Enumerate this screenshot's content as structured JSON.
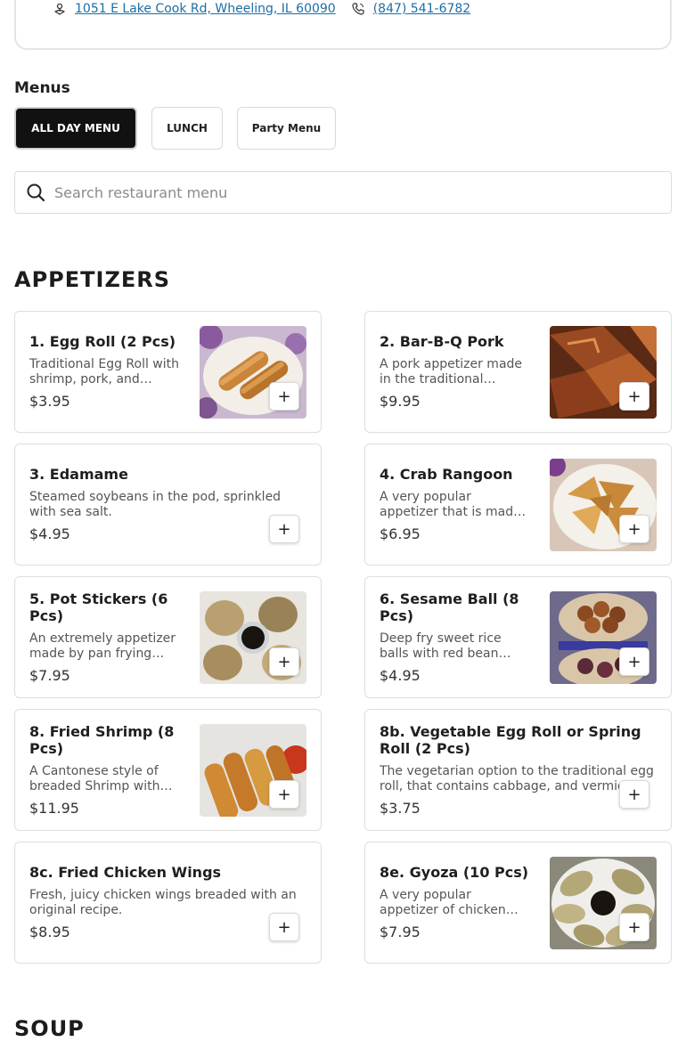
{
  "header": {
    "address": "1051 E Lake Cook Rd, Wheeling, IL 60090",
    "phone": "(847) 541-6782"
  },
  "menus": {
    "title": "Menus",
    "tabs": [
      "ALL DAY MENU",
      "LUNCH",
      "Party Menu"
    ],
    "active": "ALL DAY MENU"
  },
  "search": {
    "placeholder": "Search restaurant menu"
  },
  "sections": [
    {
      "title": "APPETIZERS",
      "items": [
        {
          "name": "1. Egg Roll (2 Pcs)",
          "desc": "Traditional Egg Roll with shrimp, pork, and cabbage wrapped and fried.",
          "price": "$3.95",
          "image": "egg-roll-photo"
        },
        {
          "name": "2. Bar-B-Q Pork",
          "desc": "A pork appetizer made in the traditional Cantonese style.",
          "price": "$9.95",
          "image": "bbq-pork-photo"
        },
        {
          "name": "3. Edamame",
          "desc": "Steamed soybeans in the pod, sprinkled with sea salt.",
          "price": "$4.95",
          "image": null
        },
        {
          "name": "4. Crab Rangoon",
          "desc": "A very popular appetizer that is made with cream cheese and crab.",
          "price": "$6.95",
          "image": "crab-rangoon-photo"
        },
        {
          "name": "5. Pot Stickers (6 Pcs)",
          "desc": "An extremely appetizer made by pan frying dumplings.",
          "price": "$7.95",
          "image": "pot-stickers-photo"
        },
        {
          "name": "6. Sesame Ball (8 Pcs)",
          "desc": "Deep fry sweet rice balls with red bean paste filling.",
          "price": "$4.95",
          "image": "sesame-ball-photo"
        },
        {
          "name": "8. Fried Shrimp (8 Pcs)",
          "desc": "A Cantonese style of breaded Shrimp with sweet and sour sauce.",
          "price": "$11.95",
          "image": "fried-shrimp-photo"
        },
        {
          "name": "8b. Vegetable Egg Roll or Spring Roll (2 Pcs)",
          "desc": "The vegetarian option to the traditional egg roll, that contains cabbage, and vermicelli.",
          "price": "$3.75",
          "image": null
        },
        {
          "name": "8c. Fried Chicken Wings",
          "desc": "Fresh, juicy chicken wings breaded with an original recipe.",
          "price": "$8.95",
          "image": null
        },
        {
          "name": "8e. Gyoza (10 Pcs)",
          "desc": "A very popular appetizer of chicken dumplings pan fried.",
          "price": "$7.95",
          "image": "gyoza-photo"
        }
      ]
    },
    {
      "title": "SOUP",
      "items": []
    }
  ],
  "add_label": "+"
}
